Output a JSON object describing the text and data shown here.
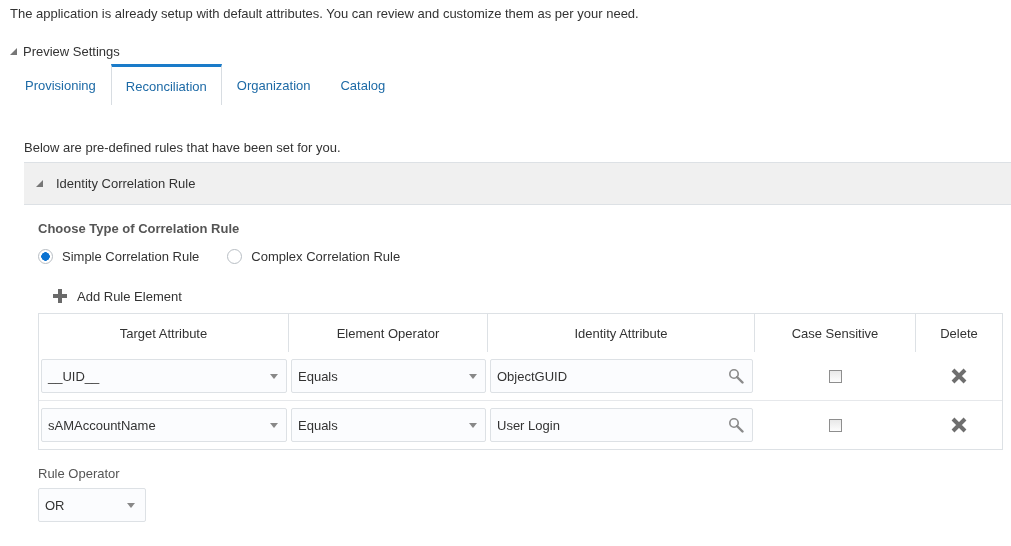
{
  "intro": "The application is already setup with default attributes. You can review and customize them as per your need.",
  "preview": {
    "label": "Preview Settings",
    "expanded": true
  },
  "tabs": [
    {
      "label": "Provisioning",
      "selected": false
    },
    {
      "label": "Reconciliation",
      "selected": true
    },
    {
      "label": "Organization",
      "selected": false
    },
    {
      "label": "Catalog",
      "selected": false
    }
  ],
  "description": "Below are pre-defined rules that have been set for you.",
  "section": {
    "title": "Identity Correlation Rule",
    "expanded": true
  },
  "rule_type": {
    "label": "Choose Type of Correlation Rule",
    "options": [
      {
        "label": "Simple Correlation Rule",
        "selected": true
      },
      {
        "label": "Complex Correlation Rule",
        "selected": false
      }
    ]
  },
  "add_button": "Add Rule Element",
  "table": {
    "columns": [
      "Target Attribute",
      "Element Operator",
      "Identity Attribute",
      "Case Sensitive",
      "Delete"
    ],
    "rows": [
      {
        "target": "__UID__",
        "operator": "Equals",
        "identity": "ObjectGUID",
        "case_sensitive": false
      },
      {
        "target": "sAMAccountName",
        "operator": "Equals",
        "identity": "User Login",
        "case_sensitive": false
      }
    ]
  },
  "rule_operator": {
    "label": "Rule Operator",
    "value": "OR"
  }
}
